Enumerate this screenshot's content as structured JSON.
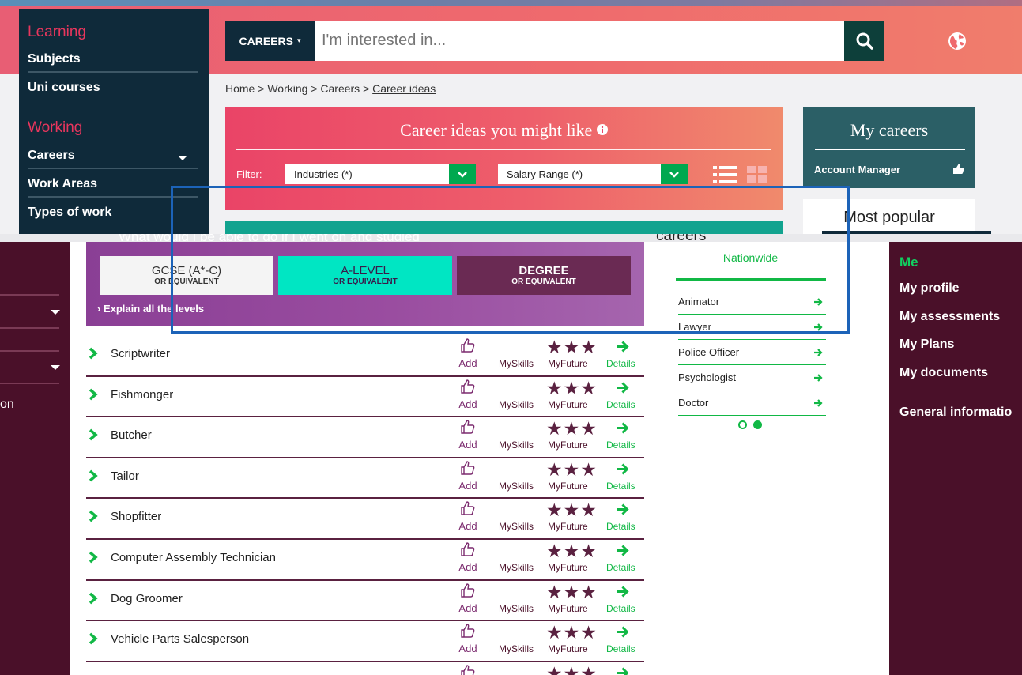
{
  "sidebar": {
    "learning_title": "Learning",
    "learning_links": [
      "Subjects",
      "Uni courses"
    ],
    "working_title": "Working",
    "working_links": [
      "Careers",
      "Work Areas",
      "Types of work"
    ]
  },
  "search": {
    "dropdown_label": "CAREERS",
    "placeholder": "I'm interested in..."
  },
  "breadcrumb": {
    "items": [
      "Home",
      "Working",
      "Careers"
    ],
    "current": "Career ideas",
    "separator": ">"
  },
  "ideas_panel": {
    "title": "Career ideas you might like",
    "filter_label": "Filter:",
    "industries": "Industries (*)",
    "salary": "Salary Range (*)"
  },
  "my_careers": {
    "title": "My careers",
    "items": [
      "Account Manager"
    ]
  },
  "most_popular": {
    "title": "Most popular"
  },
  "overlap": {
    "heading": "What would I be able to do if I went on and studied",
    "careers_word": "careers"
  },
  "levels": {
    "gcse_main": "GCSE (A*-C)",
    "gcse_sub": "OR EQUIVALENT",
    "alevel_main": "A-LEVEL",
    "alevel_sub": "OR EQUIVALENT",
    "degree_main": "DEGREE",
    "degree_sub": "OR EQUIVALENT",
    "explain": "Explain all the levels"
  },
  "career_row_labels": {
    "add": "Add",
    "myskills": "MySkills",
    "myfuture": "MyFuture",
    "details": "Details",
    "stars": "★★★"
  },
  "careers": [
    "Scriptwriter",
    "Fishmonger",
    "Butcher",
    "Tailor",
    "Shopfitter",
    "Computer Assembly Technician",
    "Dog Groomer",
    "Vehicle Parts Salesperson"
  ],
  "nationwide": {
    "title": "Nationwide",
    "items": [
      "Animator",
      "Lawyer",
      "Police Officer",
      "Psychologist",
      "Doctor"
    ]
  },
  "right_menu": {
    "title": "Me",
    "links": [
      "My profile",
      "My assessments",
      "My Plans",
      "My documents"
    ],
    "general": "General informatio"
  },
  "left_bottom": {
    "partial_text": "on"
  },
  "colors": {
    "navy": "#0f2a3a",
    "accent_pink": "#e8365d",
    "maroon": "#4a1029",
    "green": "#11b845",
    "highlight": "#1c63b8"
  }
}
